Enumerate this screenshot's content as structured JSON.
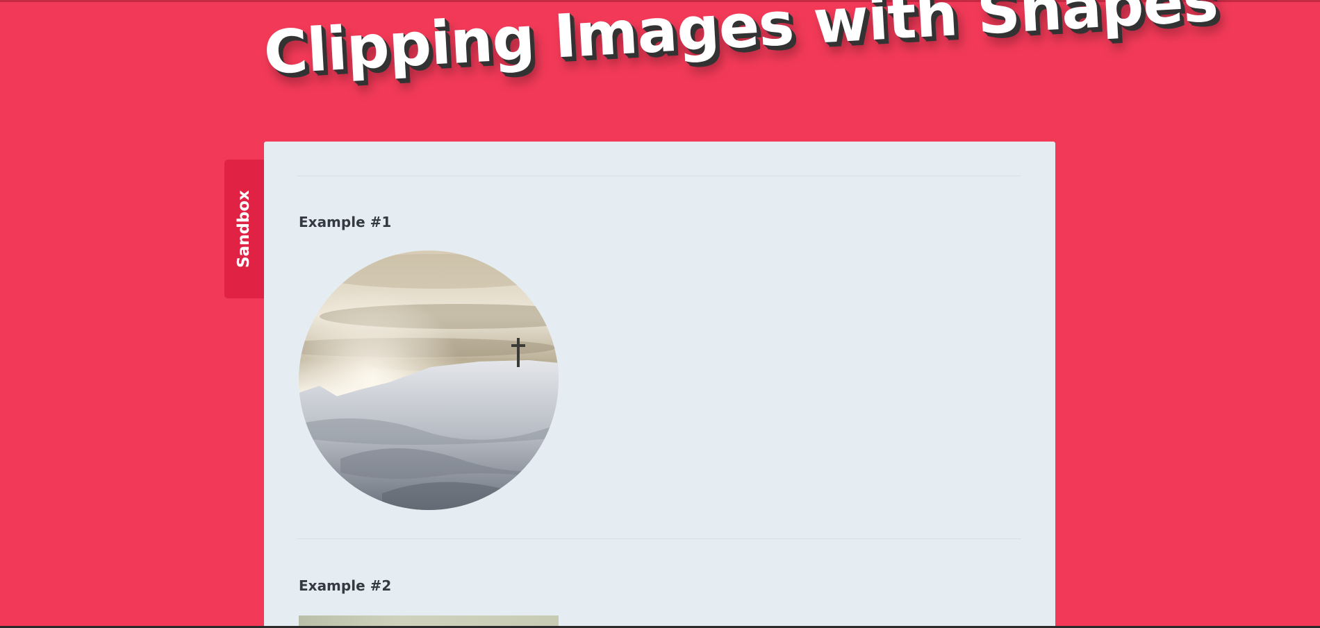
{
  "page": {
    "title": "Clipping Images with Shapes",
    "background_color": "#f23a58"
  },
  "sidebar_tab": {
    "label": "Sandbox",
    "color": "#e02244"
  },
  "panel": {
    "background_color": "#e6edf2"
  },
  "examples": [
    {
      "heading": "Example #1",
      "shape": "circle",
      "image": "snowy-mountain-cross"
    },
    {
      "heading": "Example #2",
      "shape": "rectangle",
      "image": "landscape-photo"
    }
  ]
}
